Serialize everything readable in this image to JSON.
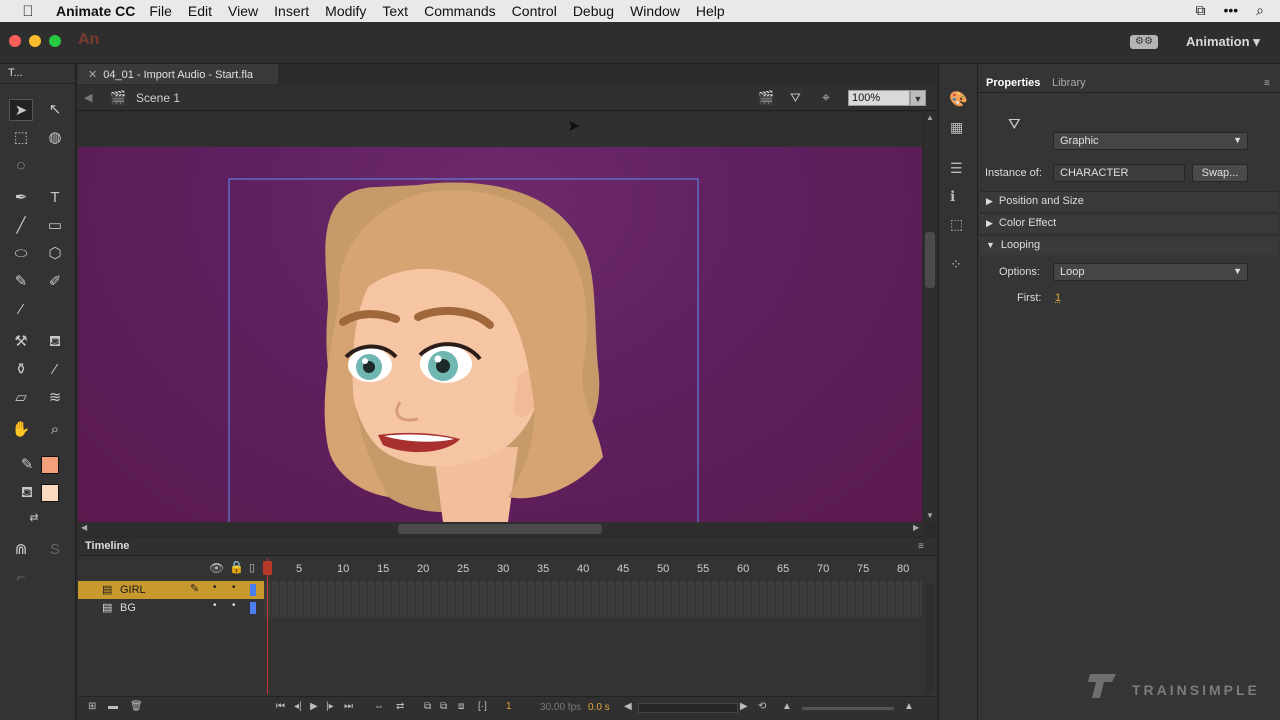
{
  "menubar": {
    "app_name": "Animate CC",
    "items": [
      "File",
      "Edit",
      "View",
      "Insert",
      "Modify",
      "Text",
      "Commands",
      "Control",
      "Debug",
      "Window",
      "Help"
    ]
  },
  "appbar": {
    "logo_text": "An",
    "workspace": "Animation",
    "workspace_arrow": "▾"
  },
  "tools": {
    "panel_label": "T..."
  },
  "document": {
    "tab_title": "04_01 - Import Audio - Start.fla",
    "tab_close": "✕",
    "scene": "Scene 1",
    "zoom": "100%"
  },
  "timeline": {
    "title": "Timeline",
    "ruler": [
      "1",
      "5",
      "10",
      "15",
      "20",
      "25",
      "30",
      "35",
      "40",
      "45",
      "50",
      "55",
      "60",
      "65",
      "70",
      "75",
      "80"
    ],
    "layers": [
      {
        "name": "GIRL",
        "selected": true
      },
      {
        "name": "BG",
        "selected": false
      }
    ],
    "current_frame": "1",
    "fps": "30.00 fps",
    "time": "0.0 s"
  },
  "properties": {
    "tabs": [
      "Properties",
      "Library"
    ],
    "symbol_type": "Graphic",
    "instance_of_label": "Instance of:",
    "instance_of": "CHARACTER",
    "swap_label": "Swap...",
    "sections": [
      "Position and Size",
      "Color Effect",
      "Looping"
    ],
    "options_label": "Options:",
    "options_value": "Loop",
    "first_label": "First:",
    "first_value": "1"
  },
  "colors": {
    "stroke": "#f4a07c",
    "fill": "#fbd9bf",
    "stage": "#5f2060",
    "accent_layer": "#c89a2e"
  },
  "watermark": "TRAINSIMPLE"
}
